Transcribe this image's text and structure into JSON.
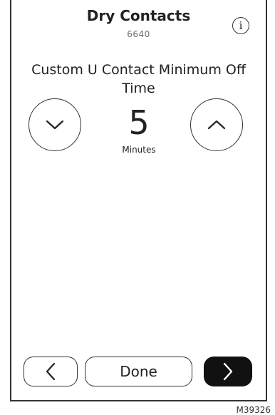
{
  "header": {
    "title": "Dry Contacts",
    "code": "6640",
    "info_icon": "i"
  },
  "setting": {
    "label": "Custom U Contact Minimum Off Time",
    "value": "5",
    "unit": "Minutes"
  },
  "footer": {
    "done_label": "Done"
  },
  "figure_code": "M39326"
}
